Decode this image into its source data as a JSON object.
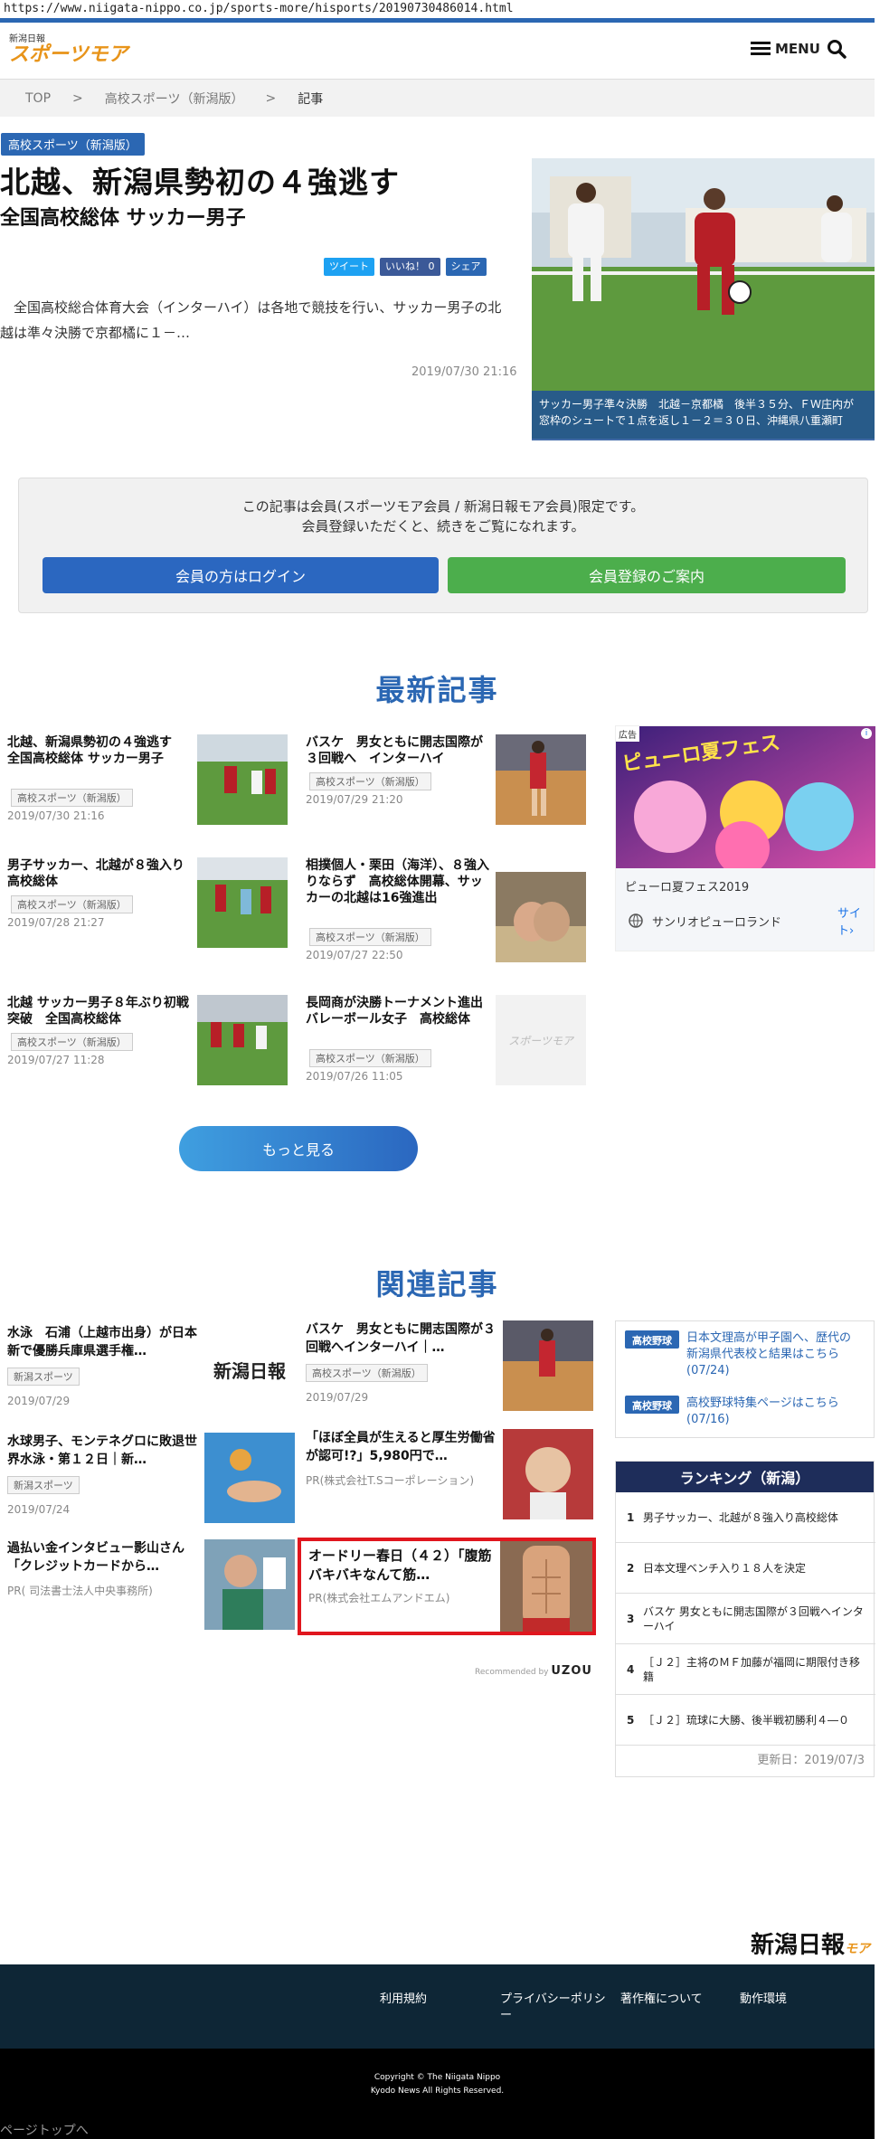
{
  "url": "https://www.niigata-nippo.co.jp/sports-more/hisports/20190730486014.html",
  "logo": {
    "small": "新潟日報",
    "big": "スポーツモア"
  },
  "header": {
    "menu": "MENU"
  },
  "breadcrumb": [
    "TOP",
    ">",
    "高校スポーツ（新潟版）",
    ">",
    "記事"
  ],
  "article": {
    "category": "高校スポーツ（新潟版）",
    "title": "北越、新潟県勢初の４強逃す",
    "subtitle": "全国高校総体 サッカー男子",
    "share": {
      "tweet": "ツイート",
      "like": "いいね！ 0",
      "share": "シェア"
    },
    "lead": "全国高校総合体育大会（インターハイ）は各地で競技を行い、サッカー男子の北越は準々決勝で京都橘に１－…",
    "date": "2019/07/30 21:16",
    "caption": "サッカー男子準々決勝　北越－京都橘　後半３５分、ＦＷ庄内が\n窓枠のシュートで１点を返し１－２＝３０日、沖縄県八重瀬町"
  },
  "member": {
    "line1": "この記事は会員(スポーツモア会員 / 新潟日報モア会員)限定です。",
    "line2": "会員登録いただくと、続きをご覧になれます。",
    "login": "会員の方はログイン",
    "register": "会員登録のご案内"
  },
  "latest": {
    "title": "最新記事",
    "items": [
      {
        "title": "北越、新潟県勢初の４強逃す　全国高校総体 サッカー男子",
        "tag": "高校スポーツ（新潟版）",
        "date": "2019/07/30 21:16"
      },
      {
        "title": "バスケ　男女ともに開志国際が３回戦へ　インターハイ",
        "tag": "高校スポーツ（新潟版）",
        "date": "2019/07/29 21:20"
      },
      {
        "title": "男子サッカー、北越が８強入り　高校総体",
        "tag": "高校スポーツ（新潟版）",
        "date": "2019/07/28 21:27"
      },
      {
        "title": "相撲個人・栗田（海洋）、８強入りならず　高校総体開幕、サッカーの北越は16強進出",
        "tag": "高校スポーツ（新潟版）",
        "date": "2019/07/27 22:50"
      },
      {
        "title": "北越 サッカー男子８年ぶり初戦突破　全国高校総体",
        "tag": "高校スポーツ（新潟版）",
        "date": "2019/07/27 11:28"
      },
      {
        "title": "長岡商が決勝トーナメント進出　バレーボール女子　高校総体",
        "tag": "高校スポーツ（新潟版）",
        "date": "2019/07/26 11:05"
      }
    ],
    "more": "もっと見る"
  },
  "ad": {
    "label": "広告",
    "name": "ピューロ夏フェス2019",
    "advertiser": "サンリオピューロランド",
    "site": "サイト",
    "banner_text": "ピューロ夏フェス"
  },
  "related": {
    "title": "関連記事",
    "items": [
      {
        "title": "水泳　石浦（上越市出身）が日本新で優勝兵庫県選手権…",
        "tag": "新潟スポーツ",
        "date": "2019/07/29"
      },
      {
        "title": "バスケ　男女ともに開志国際が３回戦へインターハイ｜…",
        "tag": "高校スポーツ（新潟版）",
        "date": "2019/07/29"
      },
      {
        "title": "水球男子、モンテネグロに敗退世界水泳・第１２日｜新…",
        "tag": "新潟スポーツ",
        "date": "2019/07/24"
      },
      {
        "title": "「ほぼ全員が生えると厚生労働省が認可!?」5,980円で…",
        "pr": "PR(株式会社T.Sコーポレーション)"
      },
      {
        "title": "過払い金インタビュー影山さん「クレジットカードから…",
        "pr": "PR( 司法書士法人中央事務所)"
      },
      {
        "title": "オードリー春日（４２）「腹筋バキバキなんて筋…",
        "pr": "PR(株式会社エムアンドエム)"
      }
    ],
    "recommended": "Recommended by",
    "uzou": "UZOU",
    "thumb_logo": "新潟日報"
  },
  "koukou": [
    {
      "label": "高校野球",
      "text": "日本文理高が甲子園へ、歴代の新潟県代表校と結果はこちら(07/24)"
    },
    {
      "label": "高校野球",
      "text": "高校野球特集ページはこちら(07/16)"
    }
  ],
  "ranking": {
    "title": "ランキング（新潟）",
    "items": [
      "男子サッカー、北越が８強入り高校総体",
      "日本文理ベンチ入り１８人を決定",
      "バスケ 男女ともに開志国際が３回戦へインターハイ",
      "［Ｊ２］主将のＭＦ加藤が福岡に期限付き移籍",
      "［Ｊ２］琉球に大勝、後半戦初勝利４―０"
    ],
    "updated": "更新日：2019/07/3"
  },
  "footer": {
    "logo": "新潟日報",
    "logo_sub": "モア",
    "links": [
      "利用規約",
      "プライバシーポリシー",
      "著作権について",
      "動作環境"
    ],
    "copy1": "Copyright © The Niigata Nippo",
    "copy2": "Kyodo News All Rights Reserved.",
    "pagetop": "ページトップへ"
  }
}
